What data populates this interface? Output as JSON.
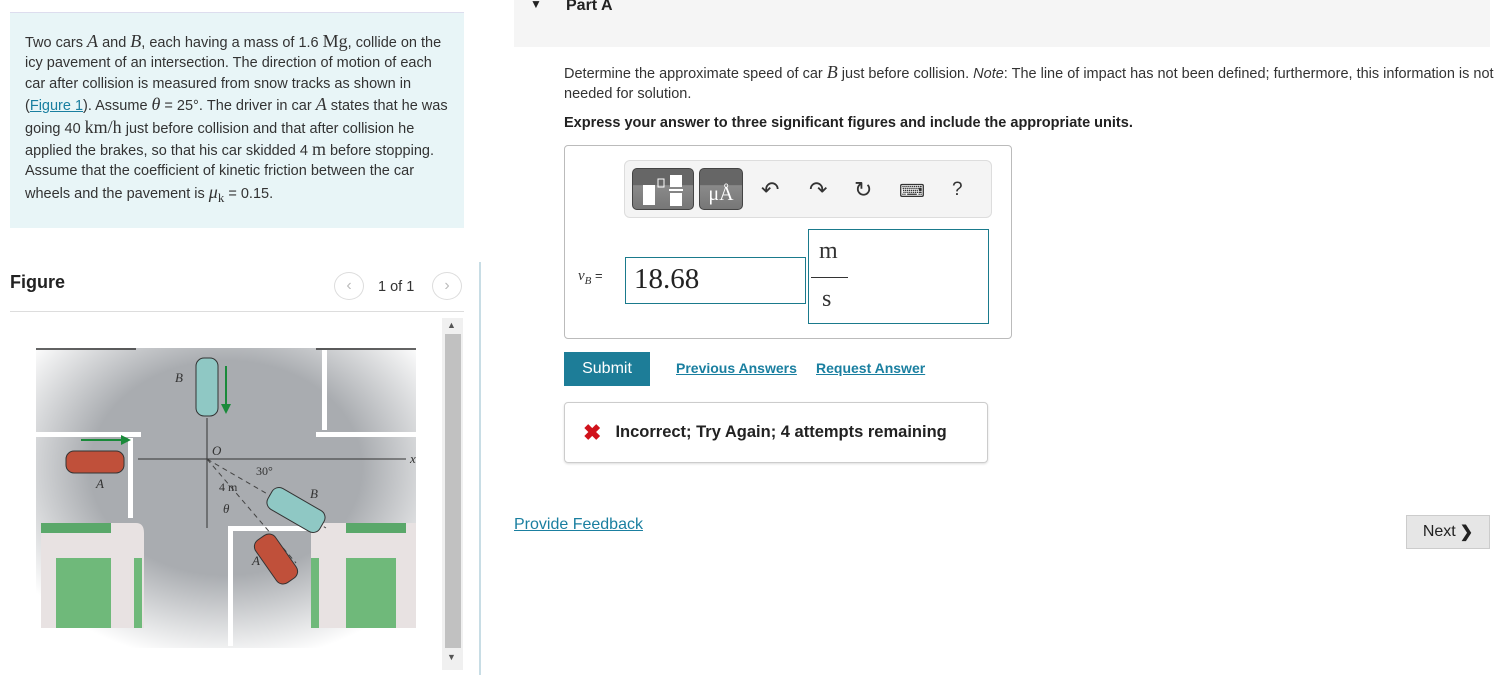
{
  "problem": {
    "t1": "Two cars ",
    "A": "A",
    "t2": " and ",
    "B": "B",
    "t3": ", each having a mass of 1.6 ",
    "Mg": "Mg",
    "t4": ",\ncollide on the icy pavement of an intersection. The direction of motion of each car after collision is measured from snow tracks as shown in (",
    "fig_link": "Figure 1",
    "t5": "). Assume ",
    "theta": "θ",
    "t6": " = 25°. The driver in car ",
    "A2": "A",
    "t7": " states that he was going 40 ",
    "kmh": "km/h",
    "t8": " just before collision and that after collision he applied the brakes, so that his car skidded 4 ",
    "m": "m",
    "t9": " before stopping. Assume that the coefficient of kinetic friction between the car wheels and the pavement is ",
    "mu": "μ",
    "k": "k",
    "t10": " = 0.15."
  },
  "figure": {
    "title": "Figure",
    "pager": "1 of 1",
    "labels": {
      "B_top": "B",
      "A_left": "A",
      "O": "O",
      "x": "x",
      "angle": "30°",
      "dist": "4 m",
      "theta": "θ",
      "B_after": "B",
      "A_after": "A"
    }
  },
  "part": {
    "label": "Part A"
  },
  "question": {
    "t1": "Determine the approximate speed of car ",
    "B": "B",
    "t2": " just before collision. ",
    "note": "Note",
    "t3": ": The line of impact has not been defined; furthermore, this information is not needed for solution."
  },
  "instruction": "Express your answer to three significant figures and include the appropriate units.",
  "toolbar": {
    "units_btn": "μÅ",
    "help": "?"
  },
  "answer": {
    "var": "v",
    "sub": "B",
    "eq": " =",
    "value": "18.68",
    "unit_num": "m",
    "unit_den": "s"
  },
  "actions": {
    "submit": "Submit",
    "previous": "Previous Answers",
    "request": "Request Answer"
  },
  "result": {
    "text": "Incorrect; Try Again; 4 attempts remaining",
    "color": "#d0121b"
  },
  "footer": {
    "feedback": "Provide Feedback",
    "next": "Next"
  }
}
